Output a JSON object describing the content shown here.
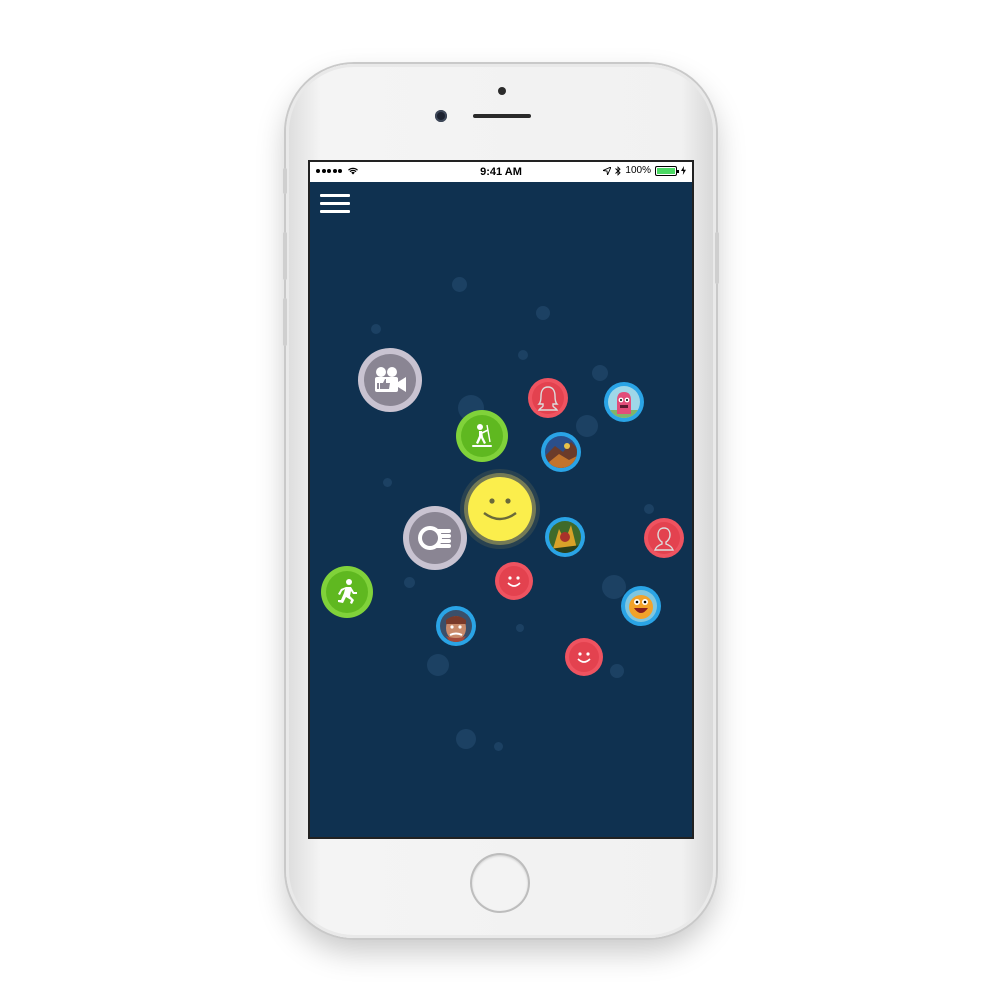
{
  "status_bar": {
    "time": "9:41 AM",
    "battery": "100%",
    "icons": [
      "signal-dots-icon",
      "wifi-icon",
      "location-icon",
      "bluetooth-icon",
      "battery-icon",
      "charging-icon"
    ]
  },
  "menu": {
    "icon": "hamburger-menu-icon"
  },
  "bubbles": [
    {
      "name": "video-like-bubble",
      "icon": "video-camera-thumbs-up-icon",
      "color": "#c9c3d1"
    },
    {
      "name": "coins-bubble",
      "icon": "coins-stack-icon",
      "color": "#c9c3d1"
    },
    {
      "name": "paddleboard-bubble",
      "icon": "paddleboard-person-icon",
      "color": "#80d23a"
    },
    {
      "name": "running-bubble",
      "icon": "running-person-icon",
      "color": "#80d23a"
    },
    {
      "name": "center-smiley-bubble",
      "icon": "smiley-face-icon",
      "color": "#fbee4c"
    },
    {
      "name": "female-avatar-bubble",
      "icon": "female-silhouette-icon",
      "color": "#ef5360"
    },
    {
      "name": "male-avatar-bubble",
      "icon": "male-silhouette-icon",
      "color": "#ef5360"
    },
    {
      "name": "smiley-bubble-1",
      "icon": "smiley-face-icon",
      "color": "#ef5360"
    },
    {
      "name": "smiley-bubble-2",
      "icon": "smiley-face-icon",
      "color": "#ef5360"
    },
    {
      "name": "pink-monster-avatar",
      "icon": "pink-monster-avatar-icon",
      "color": "#2aa4e6"
    },
    {
      "name": "game-art-avatar-1",
      "icon": "game-art-avatar-icon",
      "color": "#2aa4e6"
    },
    {
      "name": "game-art-avatar-2",
      "icon": "game-art-avatar-icon",
      "color": "#2aa4e6"
    },
    {
      "name": "warrior-avatar",
      "icon": "warrior-avatar-icon",
      "color": "#2aa4e6"
    },
    {
      "name": "orange-creature-avatar",
      "icon": "orange-creature-avatar-icon",
      "color": "#2aa4e6"
    }
  ]
}
